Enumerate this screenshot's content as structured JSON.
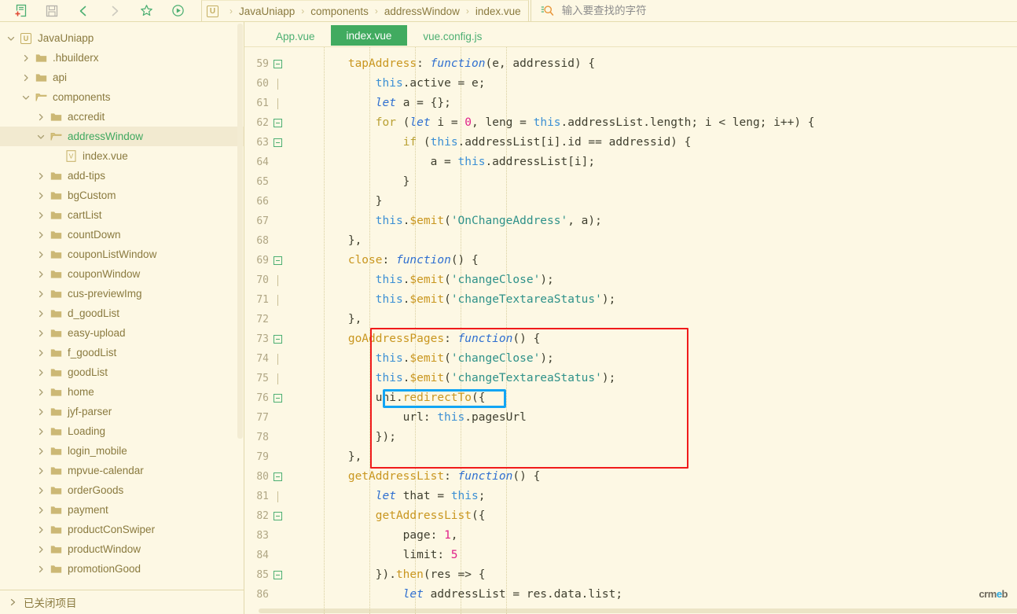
{
  "toolbar": {
    "icons": [
      {
        "name": "new-file-icon",
        "title": "新建"
      },
      {
        "name": "save-icon",
        "title": "保存"
      },
      {
        "name": "back-icon",
        "title": "后退"
      },
      {
        "name": "forward-icon",
        "title": "前进"
      },
      {
        "name": "bookmark-star-icon",
        "title": "收藏"
      },
      {
        "name": "run-preview-icon",
        "title": "运行"
      }
    ]
  },
  "breadcrumb": {
    "logo_text": "U",
    "separator": "›",
    "items": [
      "JavaUniapp",
      "components",
      "addressWindow",
      "index.vue"
    ]
  },
  "search": {
    "placeholder": "输入要查找的字符",
    "value": ""
  },
  "sidebar": {
    "closed_projects_label": "已关闭项目",
    "items": [
      {
        "label": "JavaUniapp",
        "depth": 0,
        "type": "project",
        "state": "open",
        "selected": false
      },
      {
        "label": ".hbuilderx",
        "depth": 1,
        "type": "folder",
        "state": "collapsed",
        "selected": false
      },
      {
        "label": "api",
        "depth": 1,
        "type": "folder",
        "state": "collapsed",
        "selected": false
      },
      {
        "label": "components",
        "depth": 1,
        "type": "folder",
        "state": "open",
        "selected": false
      },
      {
        "label": "accredit",
        "depth": 2,
        "type": "folder",
        "state": "collapsed",
        "selected": false
      },
      {
        "label": "addressWindow",
        "depth": 2,
        "type": "folder",
        "state": "open",
        "selected": true
      },
      {
        "label": "index.vue",
        "depth": 3,
        "type": "vuefile",
        "state": "none",
        "selected": false
      },
      {
        "label": "add-tips",
        "depth": 2,
        "type": "folder",
        "state": "collapsed",
        "selected": false
      },
      {
        "label": "bgCustom",
        "depth": 2,
        "type": "folder",
        "state": "collapsed",
        "selected": false
      },
      {
        "label": "cartList",
        "depth": 2,
        "type": "folder",
        "state": "collapsed",
        "selected": false
      },
      {
        "label": "countDown",
        "depth": 2,
        "type": "folder",
        "state": "collapsed",
        "selected": false
      },
      {
        "label": "couponListWindow",
        "depth": 2,
        "type": "folder",
        "state": "collapsed",
        "selected": false
      },
      {
        "label": "couponWindow",
        "depth": 2,
        "type": "folder",
        "state": "collapsed",
        "selected": false
      },
      {
        "label": "cus-previewImg",
        "depth": 2,
        "type": "folder",
        "state": "collapsed",
        "selected": false
      },
      {
        "label": "d_goodList",
        "depth": 2,
        "type": "folder",
        "state": "collapsed",
        "selected": false
      },
      {
        "label": "easy-upload",
        "depth": 2,
        "type": "folder",
        "state": "collapsed",
        "selected": false
      },
      {
        "label": "f_goodList",
        "depth": 2,
        "type": "folder",
        "state": "collapsed",
        "selected": false
      },
      {
        "label": "goodList",
        "depth": 2,
        "type": "folder",
        "state": "collapsed",
        "selected": false
      },
      {
        "label": "home",
        "depth": 2,
        "type": "folder",
        "state": "collapsed",
        "selected": false
      },
      {
        "label": "jyf-parser",
        "depth": 2,
        "type": "folder",
        "state": "collapsed",
        "selected": false
      },
      {
        "label": "Loading",
        "depth": 2,
        "type": "folder",
        "state": "collapsed",
        "selected": false
      },
      {
        "label": "login_mobile",
        "depth": 2,
        "type": "folder",
        "state": "collapsed",
        "selected": false
      },
      {
        "label": "mpvue-calendar",
        "depth": 2,
        "type": "folder",
        "state": "collapsed",
        "selected": false
      },
      {
        "label": "orderGoods",
        "depth": 2,
        "type": "folder",
        "state": "collapsed",
        "selected": false
      },
      {
        "label": "payment",
        "depth": 2,
        "type": "folder",
        "state": "collapsed",
        "selected": false
      },
      {
        "label": "productConSwiper",
        "depth": 2,
        "type": "folder",
        "state": "collapsed",
        "selected": false
      },
      {
        "label": "productWindow",
        "depth": 2,
        "type": "folder",
        "state": "collapsed",
        "selected": false
      },
      {
        "label": "promotionGood",
        "depth": 2,
        "type": "folder",
        "state": "collapsed",
        "selected": false
      }
    ]
  },
  "editor": {
    "tabs": [
      {
        "label": "App.vue",
        "active": false
      },
      {
        "label": "index.vue",
        "active": true
      },
      {
        "label": "vue.config.js",
        "active": false
      }
    ],
    "first_line_number": 59,
    "lines": [
      {
        "n": 59,
        "fold": "minus",
        "indent": 2,
        "tokens": [
          {
            "t": "        ",
            "c": ""
          },
          {
            "t": "tapAddress",
            "c": "t-fn"
          },
          {
            "t": ": ",
            "c": ""
          },
          {
            "t": "function",
            "c": "t-key"
          },
          {
            "t": "(e, addressid) {",
            "c": ""
          }
        ]
      },
      {
        "n": 60,
        "fold": "line",
        "indent": 3,
        "tokens": [
          {
            "t": "            ",
            "c": ""
          },
          {
            "t": "this",
            "c": "t-this"
          },
          {
            "t": ".active = e;",
            "c": ""
          }
        ]
      },
      {
        "n": 61,
        "fold": "line",
        "indent": 3,
        "tokens": [
          {
            "t": "            ",
            "c": ""
          },
          {
            "t": "let",
            "c": "t-key"
          },
          {
            "t": " a = {};",
            "c": ""
          }
        ]
      },
      {
        "n": 62,
        "fold": "minus",
        "indent": 3,
        "tokens": [
          {
            "t": "            ",
            "c": ""
          },
          {
            "t": "for",
            "c": "t-kw"
          },
          {
            "t": " (",
            "c": ""
          },
          {
            "t": "let",
            "c": "t-key"
          },
          {
            "t": " i = ",
            "c": ""
          },
          {
            "t": "0",
            "c": "t-num"
          },
          {
            "t": ", leng = ",
            "c": ""
          },
          {
            "t": "this",
            "c": "t-this"
          },
          {
            "t": ".addressList.length; i < leng; i++) {",
            "c": ""
          }
        ]
      },
      {
        "n": 63,
        "fold": "minus",
        "indent": 4,
        "tokens": [
          {
            "t": "                ",
            "c": ""
          },
          {
            "t": "if",
            "c": "t-kw"
          },
          {
            "t": " (",
            "c": ""
          },
          {
            "t": "this",
            "c": "t-this"
          },
          {
            "t": ".addressList[i].id == addressid) {",
            "c": ""
          }
        ]
      },
      {
        "n": 64,
        "fold": "",
        "indent": 5,
        "tokens": [
          {
            "t": "                    a = ",
            "c": ""
          },
          {
            "t": "this",
            "c": "t-this"
          },
          {
            "t": ".addressList[i];",
            "c": ""
          }
        ]
      },
      {
        "n": 65,
        "fold": "",
        "indent": 4,
        "tokens": [
          {
            "t": "                }",
            "c": ""
          }
        ]
      },
      {
        "n": 66,
        "fold": "",
        "indent": 3,
        "tokens": [
          {
            "t": "            }",
            "c": ""
          }
        ]
      },
      {
        "n": 67,
        "fold": "",
        "indent": 3,
        "tokens": [
          {
            "t": "            ",
            "c": ""
          },
          {
            "t": "this",
            "c": "t-this"
          },
          {
            "t": ".",
            "c": ""
          },
          {
            "t": "$emit",
            "c": "t-fn"
          },
          {
            "t": "(",
            "c": ""
          },
          {
            "t": "'OnChangeAddress'",
            "c": "t-str"
          },
          {
            "t": ", a);",
            "c": ""
          }
        ]
      },
      {
        "n": 68,
        "fold": "",
        "indent": 2,
        "tokens": [
          {
            "t": "        },",
            "c": ""
          }
        ]
      },
      {
        "n": 69,
        "fold": "minus",
        "indent": 2,
        "tokens": [
          {
            "t": "        ",
            "c": ""
          },
          {
            "t": "close",
            "c": "t-fn"
          },
          {
            "t": ": ",
            "c": ""
          },
          {
            "t": "function",
            "c": "t-key"
          },
          {
            "t": "() {",
            "c": ""
          }
        ]
      },
      {
        "n": 70,
        "fold": "line",
        "indent": 3,
        "tokens": [
          {
            "t": "            ",
            "c": ""
          },
          {
            "t": "this",
            "c": "t-this"
          },
          {
            "t": ".",
            "c": ""
          },
          {
            "t": "$emit",
            "c": "t-fn"
          },
          {
            "t": "(",
            "c": ""
          },
          {
            "t": "'changeClose'",
            "c": "t-str"
          },
          {
            "t": ");",
            "c": ""
          }
        ]
      },
      {
        "n": 71,
        "fold": "line",
        "indent": 3,
        "tokens": [
          {
            "t": "            ",
            "c": ""
          },
          {
            "t": "this",
            "c": "t-this"
          },
          {
            "t": ".",
            "c": ""
          },
          {
            "t": "$emit",
            "c": "t-fn"
          },
          {
            "t": "(",
            "c": ""
          },
          {
            "t": "'changeTextareaStatus'",
            "c": "t-str"
          },
          {
            "t": ");",
            "c": ""
          }
        ]
      },
      {
        "n": 72,
        "fold": "",
        "indent": 2,
        "tokens": [
          {
            "t": "        },",
            "c": ""
          }
        ]
      },
      {
        "n": 73,
        "fold": "minus",
        "indent": 2,
        "tokens": [
          {
            "t": "        ",
            "c": ""
          },
          {
            "t": "goAddressPages",
            "c": "t-fn"
          },
          {
            "t": ": ",
            "c": ""
          },
          {
            "t": "function",
            "c": "t-key"
          },
          {
            "t": "() {",
            "c": ""
          }
        ]
      },
      {
        "n": 74,
        "fold": "line",
        "indent": 3,
        "tokens": [
          {
            "t": "            ",
            "c": ""
          },
          {
            "t": "this",
            "c": "t-this"
          },
          {
            "t": ".",
            "c": ""
          },
          {
            "t": "$emit",
            "c": "t-fn"
          },
          {
            "t": "(",
            "c": ""
          },
          {
            "t": "'changeClose'",
            "c": "t-str"
          },
          {
            "t": ");",
            "c": ""
          }
        ]
      },
      {
        "n": 75,
        "fold": "line",
        "indent": 3,
        "tokens": [
          {
            "t": "            ",
            "c": ""
          },
          {
            "t": "this",
            "c": "t-this"
          },
          {
            "t": ".",
            "c": ""
          },
          {
            "t": "$emit",
            "c": "t-fn"
          },
          {
            "t": "(",
            "c": ""
          },
          {
            "t": "'changeTextareaStatus'",
            "c": "t-str"
          },
          {
            "t": ");",
            "c": ""
          }
        ]
      },
      {
        "n": 76,
        "fold": "minus",
        "indent": 3,
        "tokens": [
          {
            "t": "            uni.",
            "c": ""
          },
          {
            "t": "redirectTo",
            "c": "t-fn"
          },
          {
            "t": "({",
            "c": ""
          }
        ]
      },
      {
        "n": 77,
        "fold": "",
        "indent": 4,
        "tokens": [
          {
            "t": "                url: ",
            "c": ""
          },
          {
            "t": "this",
            "c": "t-this"
          },
          {
            "t": ".pagesUrl",
            "c": ""
          }
        ]
      },
      {
        "n": 78,
        "fold": "",
        "indent": 3,
        "tokens": [
          {
            "t": "            });",
            "c": ""
          }
        ]
      },
      {
        "n": 79,
        "fold": "",
        "indent": 2,
        "tokens": [
          {
            "t": "        },",
            "c": ""
          }
        ]
      },
      {
        "n": 80,
        "fold": "minus",
        "indent": 2,
        "tokens": [
          {
            "t": "        ",
            "c": ""
          },
          {
            "t": "getAddressList",
            "c": "t-fn"
          },
          {
            "t": ": ",
            "c": ""
          },
          {
            "t": "function",
            "c": "t-key"
          },
          {
            "t": "() {",
            "c": ""
          }
        ]
      },
      {
        "n": 81,
        "fold": "line",
        "indent": 3,
        "tokens": [
          {
            "t": "            ",
            "c": ""
          },
          {
            "t": "let",
            "c": "t-key"
          },
          {
            "t": " that = ",
            "c": ""
          },
          {
            "t": "this",
            "c": "t-this"
          },
          {
            "t": ";",
            "c": ""
          }
        ]
      },
      {
        "n": 82,
        "fold": "minus",
        "indent": 3,
        "tokens": [
          {
            "t": "            ",
            "c": ""
          },
          {
            "t": "getAddressList",
            "c": "t-fn"
          },
          {
            "t": "({",
            "c": ""
          }
        ]
      },
      {
        "n": 83,
        "fold": "",
        "indent": 4,
        "tokens": [
          {
            "t": "                page: ",
            "c": ""
          },
          {
            "t": "1",
            "c": "t-num"
          },
          {
            "t": ",",
            "c": ""
          }
        ]
      },
      {
        "n": 84,
        "fold": "",
        "indent": 4,
        "tokens": [
          {
            "t": "                limit: ",
            "c": ""
          },
          {
            "t": "5",
            "c": "t-num"
          }
        ]
      },
      {
        "n": 85,
        "fold": "minus",
        "indent": 3,
        "tokens": [
          {
            "t": "            }).",
            "c": ""
          },
          {
            "t": "then",
            "c": "t-fn"
          },
          {
            "t": "(res => {",
            "c": ""
          }
        ]
      },
      {
        "n": 86,
        "fold": "",
        "indent": 4,
        "tokens": [
          {
            "t": "                ",
            "c": ""
          },
          {
            "t": "let",
            "c": "t-key"
          },
          {
            "t": " addressList = res.data.list;",
            "c": ""
          }
        ]
      }
    ],
    "annotations": {
      "red_box": {
        "label": "goAddressPages-highlight"
      },
      "blue_box": {
        "label": "uni-redirectTo-highlight"
      }
    },
    "watermark": {
      "prefix": "crm",
      "accent": "e",
      "suffix": "b"
    }
  }
}
